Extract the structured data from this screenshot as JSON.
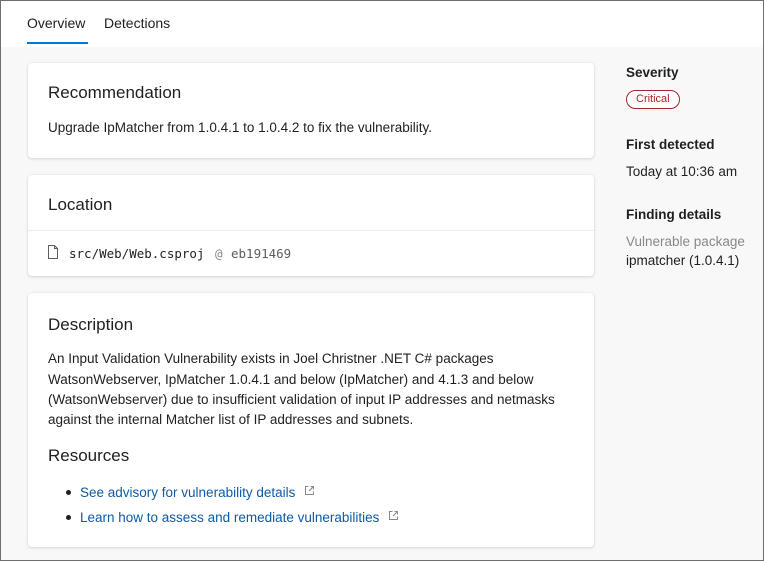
{
  "tabs": [
    {
      "label": "Overview",
      "selected": true
    },
    {
      "label": "Detections",
      "selected": false
    }
  ],
  "recommendation": {
    "title": "Recommendation",
    "text": "Upgrade IpMatcher from 1.0.4.1 to 1.0.4.2 to fix the vulnerability."
  },
  "location": {
    "title": "Location",
    "file_path": "src/Web/Web.csproj",
    "at_symbol": "@",
    "commit": "eb191469"
  },
  "description": {
    "title": "Description",
    "lines": [
      "An Input Validation Vulnerability exists in Joel Christner .NET C# packages",
      "WatsonWebserver, IpMatcher 1.0.4.1 and below (IpMatcher) and 4.1.3 and below",
      "(WatsonWebserver) due to insufficient validation of input IP addresses and netmasks",
      "against the internal Matcher list of IP addresses and subnets."
    ]
  },
  "resources": {
    "title": "Resources",
    "links": [
      {
        "label": "See advisory for vulnerability details",
        "icon": "external-link-icon"
      },
      {
        "label": "Learn how to assess and remediate vulnerabilities",
        "icon": "external-link-icon"
      }
    ]
  },
  "sidebar": {
    "severity_label": "Severity",
    "severity_value": "Critical",
    "first_detected_label": "First detected",
    "first_detected_value": "Today at 10:36 am",
    "finding_details_label": "Finding details",
    "package_label": "Vulnerable package",
    "package_value": "ipmatcher (1.0.4.1)"
  },
  "colors": {
    "accent": "#0078d4",
    "link": "#0f5ba7",
    "critical": "#a4262c"
  }
}
